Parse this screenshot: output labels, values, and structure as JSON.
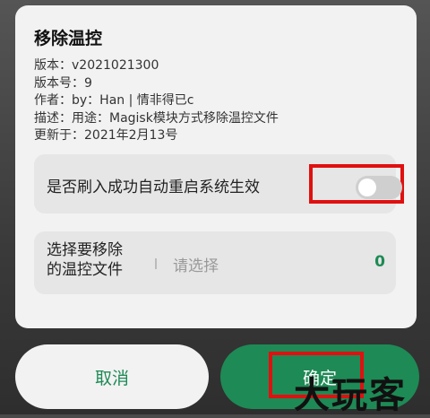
{
  "dialog": {
    "title": "移除温控",
    "info": [
      "版本：v2021021300",
      "版本号：9",
      "作者：by：Han | 情非得已c",
      "描述：用途：Magisk模块方式移除温控文件",
      "更新于：2021年2月13号"
    ],
    "reboot_label": "是否刷入成功自动重启系统生效",
    "reboot_toggle_on": false,
    "select_label_line1": "选择要移除",
    "select_label_line2": "的温控文件",
    "select_placeholder": "请选择",
    "select_count": "0"
  },
  "buttons": {
    "cancel_label": "取消",
    "ok_label": "确定"
  },
  "watermark": "大玩客",
  "colors": {
    "accent": "#1e8a55",
    "highlight": "#e01010"
  }
}
